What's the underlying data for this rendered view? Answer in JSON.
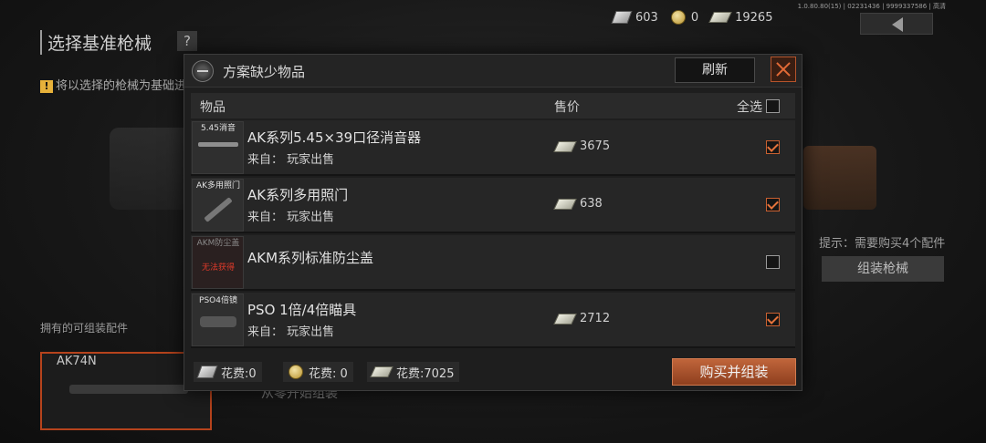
{
  "background": {
    "title": "选择基准枪械",
    "help_label": "?",
    "notice_mark": "!",
    "notice": "将以选择的枪械为基础进行",
    "version": "1.0.80.80(15) | 02231436 | 9999337586 | 高清",
    "tip": "提示：需要购买4个配件",
    "assemble_label": "组装枪械",
    "owned_label": "拥有的可组装配件",
    "owned_gun": "AK74N",
    "start_label": "从零开始组装"
  },
  "currency": [
    {
      "icon": "ticket-icon",
      "value": "603"
    },
    {
      "icon": "coin-icon",
      "value": "0"
    },
    {
      "icon": "cash-icon",
      "value": "19265"
    }
  ],
  "modal": {
    "title": "方案缺少物品",
    "refresh_label": "刷新",
    "close_icon": "close-icon",
    "columns": {
      "item": "物品",
      "price": "售价",
      "select_all": "全选"
    },
    "select_all_checked": false,
    "items": [
      {
        "thumb_label": "5.45消音",
        "name": "AK系列5.45×39口径消音器",
        "source": "来自：  玩家出售",
        "price": "3675",
        "checked": true,
        "available": true
      },
      {
        "thumb_label": "AK多用照门",
        "name": "AK系列多用照门",
        "source": "来自：  玩家出售",
        "price": "638",
        "checked": true,
        "available": true
      },
      {
        "thumb_label": "AKM防尘盖",
        "unavailable_label": "无法获得",
        "name": "AKM系列标准防尘盖",
        "source": "",
        "price": "",
        "checked": false,
        "available": false
      },
      {
        "thumb_label": "PSO4倍镜",
        "name": "PSO 1倍/4倍瞄具",
        "source": "来自：  玩家出售",
        "price": "2712",
        "checked": true,
        "available": true
      }
    ],
    "costs": [
      {
        "icon": "ticket-icon",
        "label": "花费:0"
      },
      {
        "icon": "coin-icon",
        "label": "花费: 0"
      },
      {
        "icon": "cash-icon",
        "label": "花费:7025"
      }
    ],
    "buy_label": "购买并组装"
  }
}
